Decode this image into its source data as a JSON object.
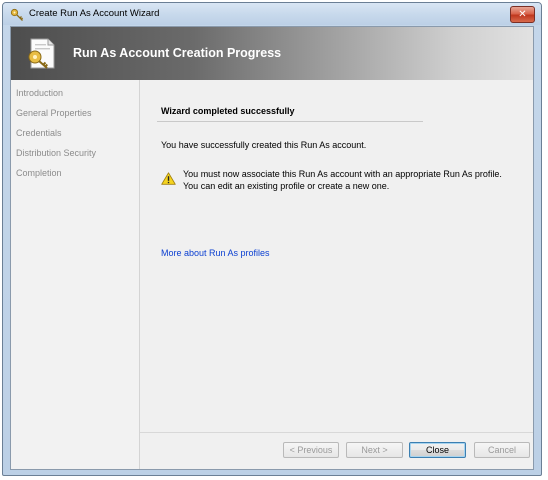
{
  "window": {
    "title": "Create Run As Account Wizard",
    "close_glyph": "✕"
  },
  "banner": {
    "title": "Run As Account Creation Progress",
    "icon": "key-document-icon"
  },
  "nav": {
    "items": [
      {
        "label": "Introduction"
      },
      {
        "label": "General Properties"
      },
      {
        "label": "Credentials"
      },
      {
        "label": "Distribution Security"
      },
      {
        "label": "Completion"
      }
    ]
  },
  "content": {
    "heading": "Wizard completed successfully",
    "success_message": "You have successfully created this Run As account.",
    "warning": {
      "icon": "warning-icon",
      "line1": "You must now associate this Run As account with an appropriate Run As profile.",
      "line2": "You can edit an existing profile or create a new one."
    },
    "link_text": "More about Run As profiles"
  },
  "buttons": {
    "previous": "< Previous",
    "next": "Next >",
    "close": "Close",
    "cancel": "Cancel"
  },
  "colors": {
    "link": "#0b3fd1",
    "disabled_text": "#9a9a9a",
    "banner_dark": "#4d4d4d",
    "warning_yellow": "#f5d31e"
  }
}
